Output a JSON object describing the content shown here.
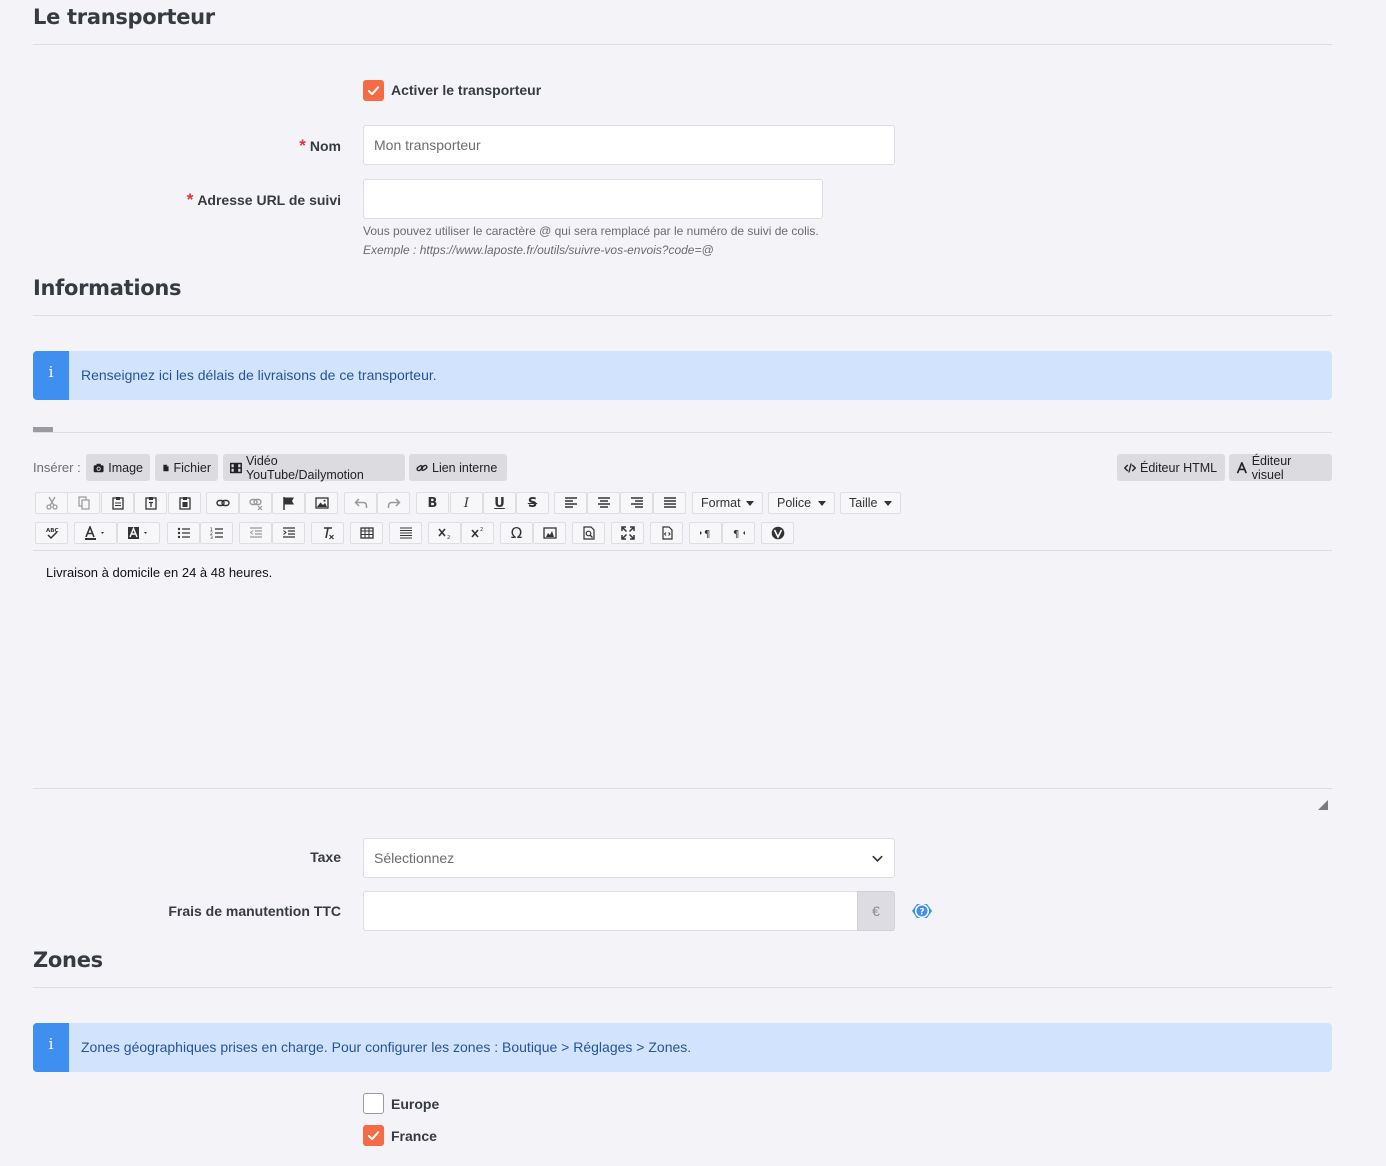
{
  "carrier": {
    "title": "Le transporteur",
    "activate_label": "Activer le transporteur",
    "activate_checked": true,
    "name_label": "Nom",
    "name_placeholder": "Mon transporteur",
    "tracking_label": "Adresse URL de suivi",
    "tracking_value": "",
    "tracking_help": "Vous pouvez utiliser le caractère @ qui sera remplacé par le numéro de suivi de colis.",
    "tracking_example": "Exemple : https://www.laposte.fr/outils/suivre-vos-envois?code=@"
  },
  "informations": {
    "title": "Informations",
    "alert_icon": "i",
    "alert_text": "Renseignez ici les délais de livraisons de ce transporteur.",
    "insert_label": "Insérer :",
    "insert_buttons": [
      {
        "label": "Image",
        "icon": "camera-icon"
      },
      {
        "label": "Fichier",
        "icon": "file-icon"
      },
      {
        "label": "Vidéo YouTube/Dailymotion",
        "icon": "film-icon"
      },
      {
        "label": "Lien interne",
        "icon": "link-icon"
      }
    ],
    "html_editor_label": "Éditeur HTML",
    "visual_editor_label": "Éditeur visuel",
    "toolbar": {
      "format_label": "Format",
      "font_label": "Police",
      "size_label": "Taille",
      "bold": "B",
      "italic": "I",
      "underline": "U",
      "strike": "S",
      "omega": "Ω"
    },
    "editor_content": "Livraison à domicile en 24 à 48 heures.",
    "tax_label": "Taxe",
    "tax_placeholder": "Sélectionnez",
    "handling_label": "Frais de manutention TTC",
    "handling_value": "",
    "currency_symbol": "€",
    "help_icon": "question-icon"
  },
  "zones": {
    "title": "Zones",
    "alert_icon": "i",
    "alert_text": "Zones géographiques prises en charge. Pour configurer les zones : Boutique > Réglages > Zones.",
    "items": [
      {
        "label": "Europe",
        "checked": false
      },
      {
        "label": "France",
        "checked": true
      }
    ]
  },
  "colors": {
    "accent": "#f46b45",
    "info": "#3f8ff0",
    "info_bg": "#d2e4fd",
    "required": "#e0313a"
  }
}
